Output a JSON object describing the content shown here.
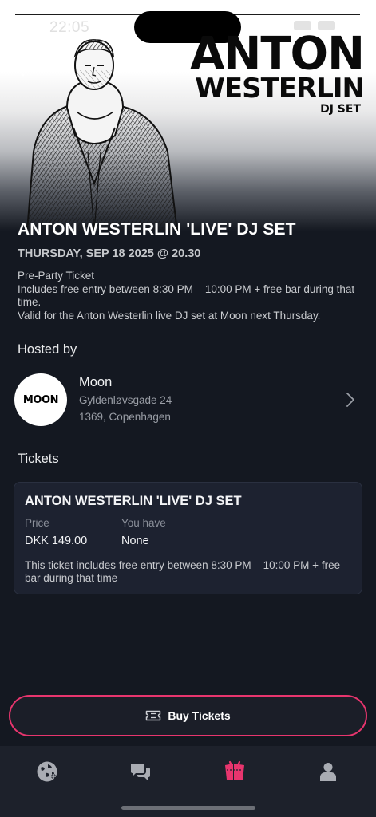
{
  "status_bar": {
    "time": "22:05"
  },
  "hero": {
    "title_line1": "ANTON",
    "title_line2": "WESTERLIN",
    "title_line3": "DJ SET"
  },
  "event": {
    "title": "ANTON WESTERLIN 'LIVE' DJ SET",
    "date": "THURSDAY, SEP 18 2025 @ 20.30",
    "description_lines": [
      "Pre-Party Ticket",
      "Includes free entry between 8:30 PM – 10:00 PM + free bar during that time.",
      "Valid for the Anton Westerlin live DJ set at Moon next Thursday."
    ]
  },
  "host": {
    "section_label": "Hosted by",
    "avatar_text": "MOON",
    "name": "Moon",
    "address_line1": "Gyldenløvsgade 24",
    "address_line2": "1369, Copenhagen"
  },
  "tickets": {
    "section_label": "Tickets",
    "card": {
      "title": "ANTON WESTERLIN 'LIVE' DJ SET",
      "price_label": "Price",
      "price_value": "DKK 149.00",
      "you_have_label": "You have",
      "you_have_value": "None",
      "description": "This ticket includes free entry between 8:30 PM – 10:00 PM + free bar during that time"
    }
  },
  "buy_button": {
    "label": "Buy Tickets"
  },
  "nav": {
    "items": [
      {
        "icon": "globe-icon",
        "active": false
      },
      {
        "icon": "chat-icon",
        "active": false
      },
      {
        "icon": "tickets-icon",
        "active": true
      },
      {
        "icon": "profile-icon",
        "active": false
      }
    ]
  },
  "colors": {
    "accent": "#e8356e",
    "background": "#141821",
    "card": "#1d2230",
    "nav_inactive": "#a9acb3"
  }
}
